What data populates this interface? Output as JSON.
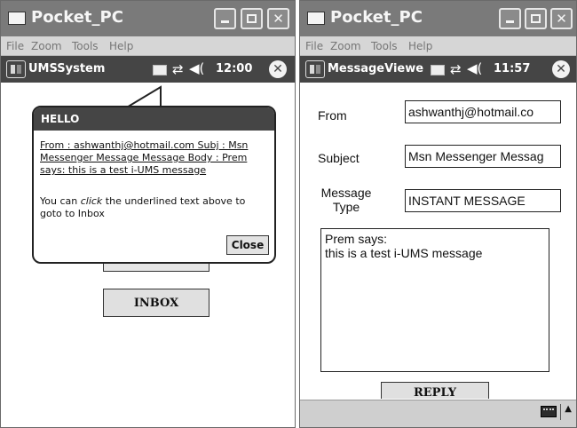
{
  "left": {
    "title": "Pocket_PC",
    "menu": [
      "File",
      "Zoom",
      "Tools",
      "Help"
    ],
    "taskbar": {
      "app": "UMSSystem",
      "clock": "12:00"
    },
    "balloon": {
      "heading": "HELLO",
      "link_text": "From : ashwanthj@hotmail.com Subj : Msn Messenger Message Message Body : Prem says: this is a test i-UMS message",
      "note_prefix": "You can ",
      "note_em": "click",
      "note_suffix": " the underlined text above to goto to Inbox",
      "close_label": "Close"
    },
    "inbox_label": "INBOX"
  },
  "right": {
    "title": "Pocket_PC",
    "menu": [
      "File",
      "Zoom",
      "Tools",
      "Help"
    ],
    "taskbar": {
      "app": "MessageViewe",
      "clock": "11:57"
    },
    "form": {
      "from_label": "From",
      "from_value": "ashwanthj@hotmail.co",
      "subject_label": "Subject",
      "subject_value": "Msn Messenger Messag",
      "type_label_1": "Message",
      "type_label_2": "Type",
      "type_value": "INSTANT MESSAGE",
      "body": "Prem says:\nthis is a test i-UMS message"
    },
    "reply_label": "REPLY"
  },
  "icons": {
    "minimize": "minimize-icon",
    "maximize": "maximize-icon",
    "close": "close-icon",
    "start": "windows-start-icon",
    "keyboard": "keyboard-icon",
    "connectivity": "connectivity-icon",
    "volume": "volume-icon",
    "app_close": "app-close-icon",
    "sip": "input-panel-icon"
  },
  "colors": {
    "titlebar": "#7a7a7a",
    "taskbar": "#454545",
    "frame": "#9e9e9e"
  }
}
